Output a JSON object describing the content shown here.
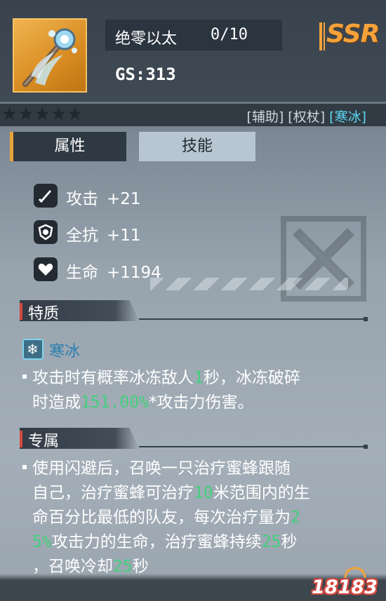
{
  "item": {
    "name": "绝零以太",
    "level": "0/10",
    "gs": "GS:313",
    "rarity": "SSR",
    "stars": "★★★★★"
  },
  "tags": {
    "support": "[辅助]",
    "staff": "[权杖]",
    "ice": "[寒冰]"
  },
  "tabs": {
    "attributes": "属性",
    "skills": "技能"
  },
  "stats": [
    {
      "label": "攻击",
      "value": "+21"
    },
    {
      "label": "全抗",
      "value": "+11"
    },
    {
      "label": "生命",
      "value": "+1194"
    }
  ],
  "trait_section": {
    "title": "特质",
    "element_name": "寒冰",
    "line1": "攻击时有概率冰冻敌人",
    "line1_hl": "1",
    "line1_end": "秒，冰冻破碎",
    "line2": "时造成",
    "line2_hl": "151.00%",
    "line2_end": "*攻击力伤害。"
  },
  "exclusive_section": {
    "title": "专属",
    "l1": "使用闪避后，召唤一只治疗蜜蜂跟随",
    "l2_a": "自己，治疗蜜蜂可治疗",
    "l2_hl": "10",
    "l2_b": "米范围内的生",
    "l3_a": "命百分比最低的队友，每次治疗量为",
    "l3_hl": "2",
    "l4_hl": "5%",
    "l4_a": "攻击力的生命，治疗蜜蜂持续",
    "l4_hl2": "25",
    "l4_b": "秒",
    "l5_a": "，召唤冷却",
    "l5_hl": "25",
    "l5_b": "秒"
  },
  "watermark": {
    "logo": "18183"
  }
}
